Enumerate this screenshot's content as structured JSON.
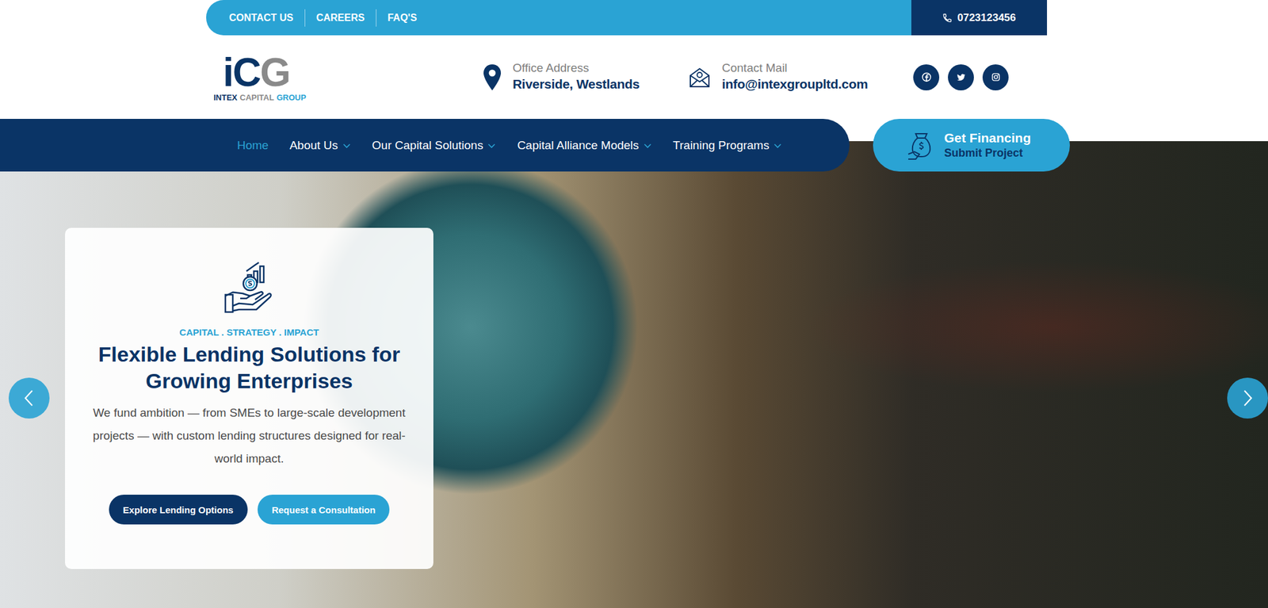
{
  "top_bar": {
    "links": [
      "CONTACT US",
      "CAREERS",
      "FAQ'S"
    ],
    "phone": "0723123456"
  },
  "logo": {
    "letters": [
      {
        "text": "i",
        "color": "#0a3466"
      },
      {
        "text": "C",
        "color": "#0a3466"
      },
      {
        "text": "G",
        "color": "#8a8a8a"
      }
    ],
    "words": [
      {
        "text": "INTEX",
        "color": "#0a3466"
      },
      {
        "text": "CAPITAL",
        "color": "#8a8a8a"
      },
      {
        "text": "GROUP",
        "color": "#2aa3d4"
      }
    ]
  },
  "contact": [
    {
      "label": "Office Address",
      "value": "Riverside, Westlands"
    },
    {
      "label": "Contact Mail",
      "value": "info@intexgroupltd.com"
    }
  ],
  "nav": {
    "items": [
      {
        "label": "Home",
        "selected": true,
        "has_dropdown": false
      },
      {
        "label": "About Us",
        "selected": false,
        "has_dropdown": true
      },
      {
        "label": "Our Capital Solutions",
        "selected": false,
        "has_dropdown": true
      },
      {
        "label": "Capital Alliance Models",
        "selected": false,
        "has_dropdown": true
      },
      {
        "label": "Training Programs",
        "selected": false,
        "has_dropdown": true
      }
    ]
  },
  "cta": {
    "title": "Get Financing",
    "subtitle": "Submit Project"
  },
  "hero": {
    "eyebrow": "CAPITAL . STRATEGY . IMPACT",
    "title": "Flexible Lending Solutions for Growing Enterprises",
    "text": "We fund ambition — from SMEs to large-scale development projects — with custom lending structures designed for real-world impact.",
    "buttons": [
      {
        "label": "Explore Lending Options",
        "kind": "primary"
      },
      {
        "label": "Request a Consultation",
        "kind": "secondary"
      }
    ]
  }
}
